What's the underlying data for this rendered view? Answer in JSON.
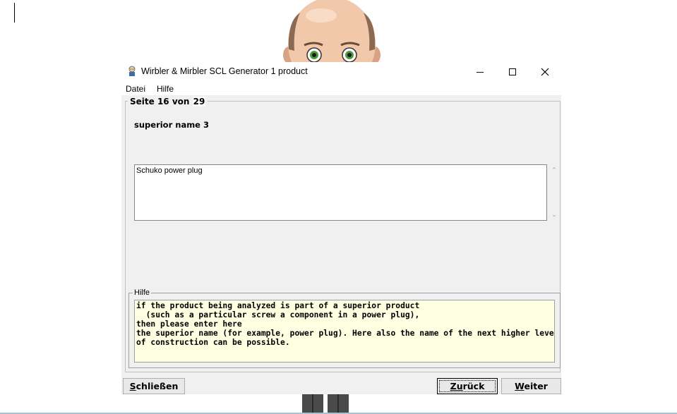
{
  "window": {
    "title": "Wirbler & Mirbler SCL Generator 1 product"
  },
  "menu": {
    "items": [
      {
        "label": "Datei"
      },
      {
        "label": "Hilfe"
      }
    ]
  },
  "page": {
    "legend_prefix": "Seite 16 von ",
    "total": "29"
  },
  "field": {
    "title": "superior name 3",
    "value": "Schuko power plug"
  },
  "help": {
    "legend": "Hilfe",
    "text": "if the product being analyzed is part of a superior product\n  (such as a particular screw a component in a power plug),\nthen please enter here\nthe superior name (for example, power plug). Here also the name of the next higher level\nof construction can be possible."
  },
  "buttons": {
    "close": {
      "accel": "S",
      "rest": "chließen"
    },
    "back": {
      "pre": "Z",
      "accel": "u",
      "rest": "rück"
    },
    "next": {
      "accel": "W",
      "rest": "eiter"
    }
  }
}
